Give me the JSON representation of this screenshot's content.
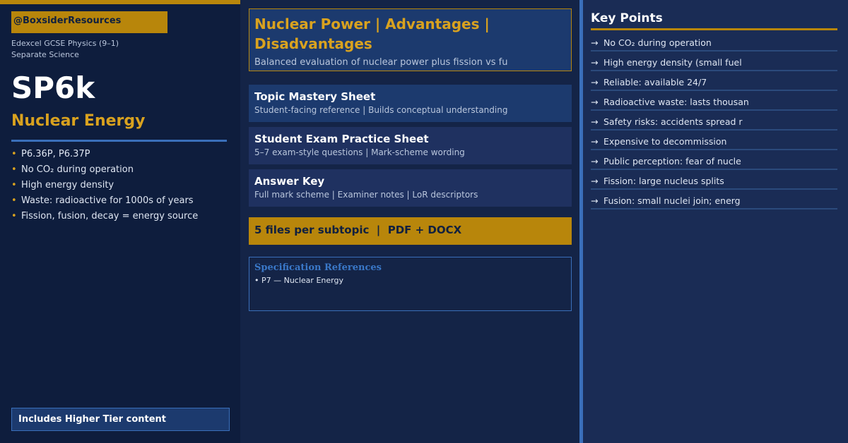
{
  "left": {
    "handle": "@BoxsiderResources",
    "course_line1": "Edexcel GCSE Physics (9–1)",
    "course_line2": "Separate Science",
    "code": "SP6k",
    "subtopic": "Nuclear Energy",
    "bullets": [
      "P6.36P, P6.37P",
      "No CO₂ during operation",
      "High energy density",
      "Waste: radioactive for 1000s of years",
      "Fission, fusion, decay = energy source"
    ],
    "higher_badge": "Includes Higher Tier content"
  },
  "middle": {
    "title": "Nuclear Power | Advantages | Disadvantages",
    "description": "Balanced evaluation of nuclear power plus fission vs fu",
    "cards": [
      {
        "heading": "Topic Mastery Sheet",
        "sub": "Student-facing reference | Builds conceptual understanding"
      },
      {
        "heading": "Student Exam Practice Sheet",
        "sub": "5–7 exam-style questions | Mark-scheme wording"
      },
      {
        "heading": "Answer Key",
        "sub": "Full mark scheme | Examiner notes | LoR descriptors"
      }
    ],
    "files_banner": "5 files per subtopic  |  PDF + DOCX",
    "spec": {
      "heading": "Specification References",
      "item": "• P7 — Nuclear Energy"
    }
  },
  "right": {
    "title": "Key Points",
    "points": [
      "No CO₂ during operation",
      "High energy density (small fuel",
      "Reliable: available 24/7",
      "Radioactive waste: lasts thousan",
      "Safety risks: accidents spread r",
      "Expensive to decommission",
      "Public perception: fear of nucle",
      "Fission: large nucleus splits",
      "Fusion: small nuclei join; energ"
    ]
  },
  "icons": {
    "bullet": "•",
    "arrow": "→"
  },
  "colors": {
    "navy_dark": "#0e1d3d",
    "navy": "#142447",
    "navy_light": "#1a2c55",
    "accent_gold": "#b8860b",
    "gold_text": "#d9a21f",
    "accent_blue": "#3a6fba"
  }
}
